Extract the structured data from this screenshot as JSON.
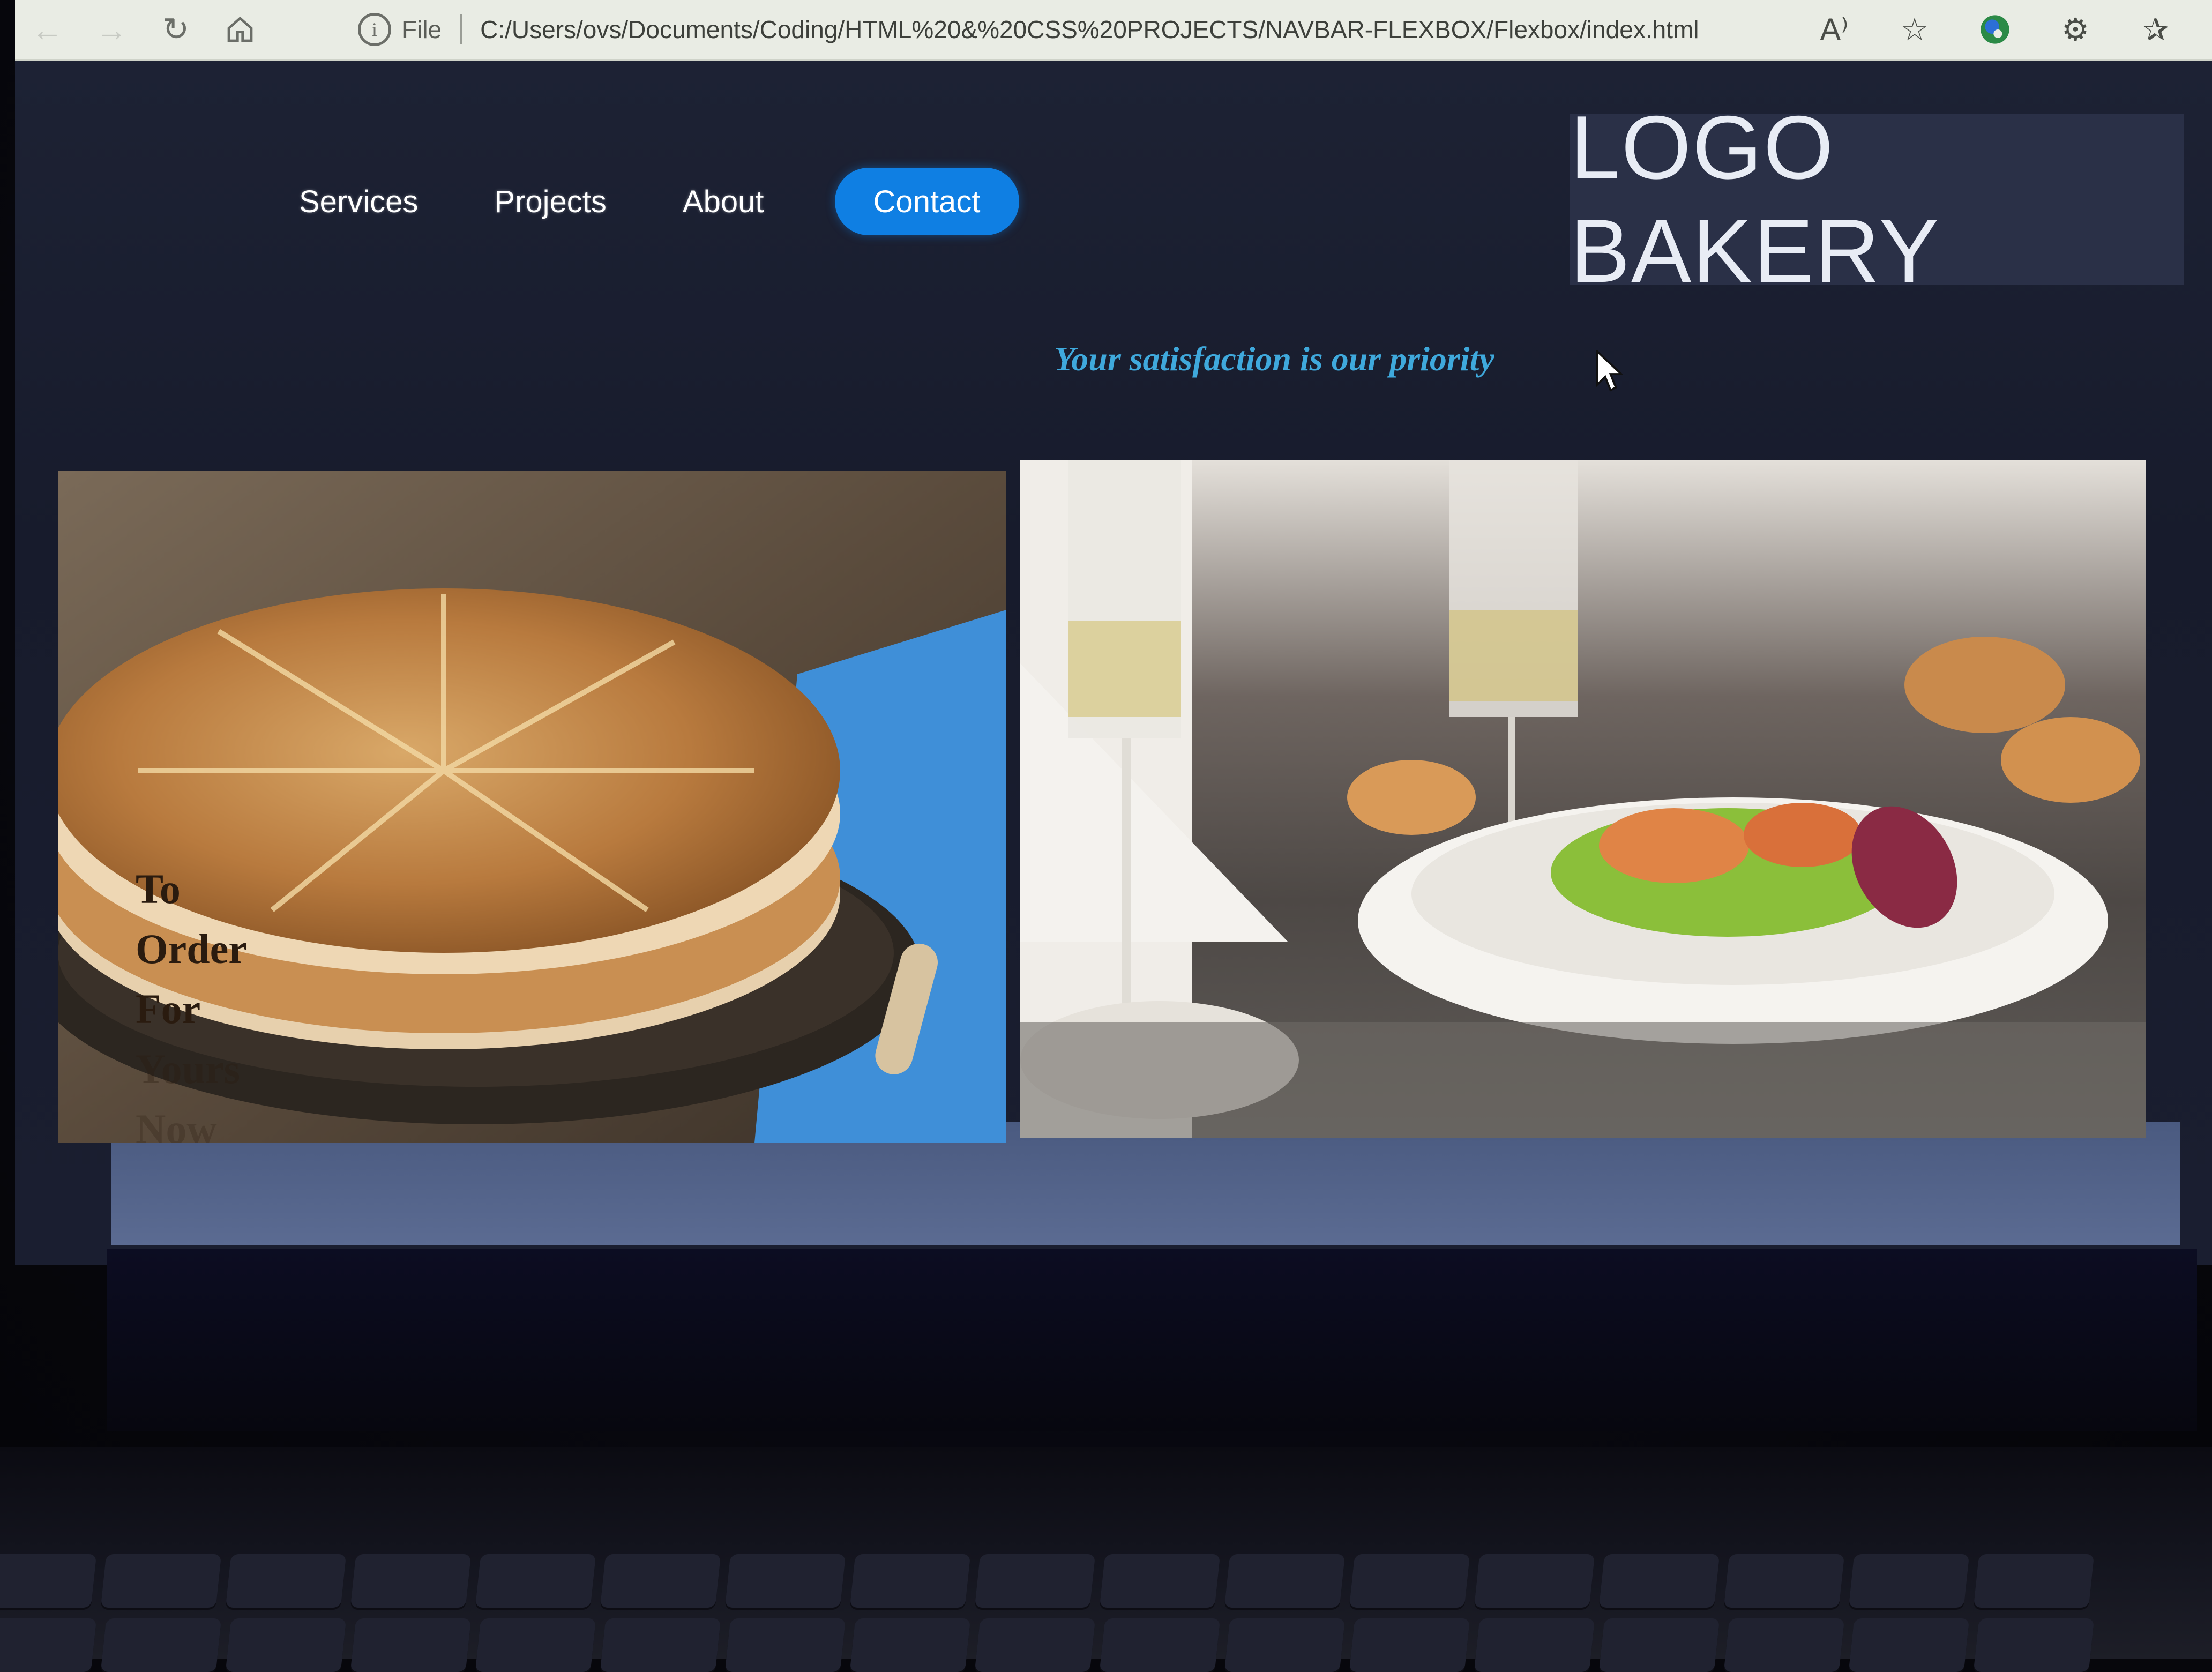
{
  "browser": {
    "nav_icons": [
      "back-icon",
      "forward-icon",
      "reload-icon",
      "home-icon"
    ],
    "address": {
      "scheme_label": "File",
      "url": "C:/Users/ovs/Documents/Coding/HTML%20&%20CSS%20PROJECTS/NAVBAR-FLEXBOX/Flexbox/index.html"
    },
    "toolbar_icons": [
      "read-aloud-icon",
      "add-favorite-icon",
      "edge-icon",
      "extensions-icon",
      "favorites-icon",
      "collections-icon"
    ]
  },
  "page": {
    "nav": {
      "items": [
        {
          "label": "Services"
        },
        {
          "label": "Projects"
        },
        {
          "label": "About"
        }
      ],
      "contact_label": "Contact"
    },
    "logo": "LOGO BAKERY",
    "tagline": "Your satisfaction is our priority",
    "gallery": {
      "bread_overlay_lines": [
        "To",
        "Order",
        "For",
        "Yours",
        "Now"
      ]
    }
  },
  "colors": {
    "page_bg": "#1b2032",
    "contact_button": "#0f7fe3",
    "logo_box": "#2a3047",
    "tagline": "#3fa9dc"
  }
}
